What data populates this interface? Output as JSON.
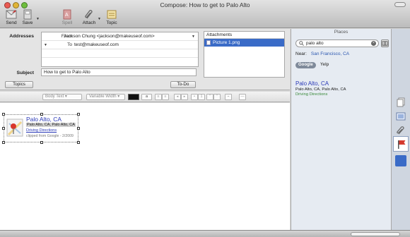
{
  "window": {
    "title": "Compose: How to get to Palo Alto"
  },
  "toolbar": {
    "send": "Send",
    "save": "Save",
    "spell": "Spell",
    "attach": "Attach",
    "topic": "Topic"
  },
  "header": {
    "addresses_label": "Addresses",
    "from_type": "From",
    "from_value": "Jackson Chung <jackson@makeuseof.com>",
    "to_type": "To",
    "to_value": "test@makeuseof.com",
    "subject_label": "Subject",
    "subject_value": "How to get to Palo Alto",
    "topics_button": "Topics",
    "todo_button": "To-Do",
    "attachments_label": "Attachments",
    "attachment_file": "Picture 1.png"
  },
  "format": {
    "style": "Body Text",
    "width": "Variable Width",
    "size": "a"
  },
  "clip": {
    "title": "Palo Alto, CA",
    "address": "Palo Alto, CA, Palo Alto, CA",
    "link": "Driving Directions",
    "source": "clipped from Google - 2/2009"
  },
  "places": {
    "title": "Places",
    "search_value": "palo alto",
    "near_label": "Near:",
    "near_city": "San Francisco, CA",
    "providers": [
      "Google",
      "Yelp"
    ],
    "result": {
      "title": "Palo Alto, CA",
      "address": "Palo Alto, CA, Palo Alto, CA",
      "link": "Driving Directions"
    }
  },
  "colors": {
    "accent": "#3a6bc7",
    "link": "#2b3ab7",
    "sidebar_bg": "#e6ebf2"
  },
  "icons": [
    "send-icon",
    "save-icon",
    "spell-icon",
    "attach-icon",
    "topic-icon",
    "map-pin-icon",
    "search-icon",
    "clear-icon",
    "map-icon",
    "pages-icon",
    "paperclip-icon",
    "flag-icon"
  ]
}
